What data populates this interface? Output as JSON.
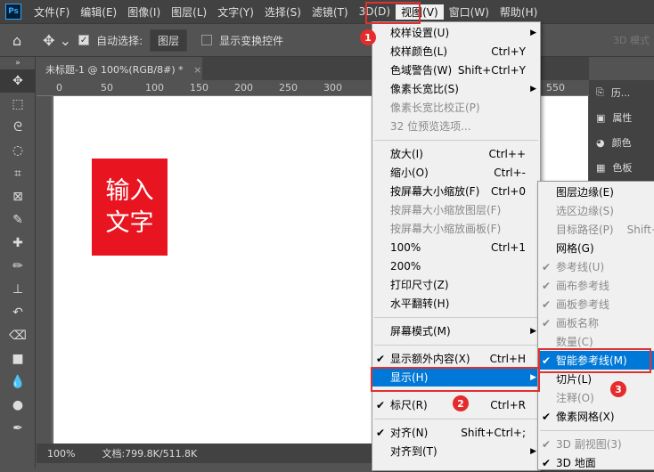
{
  "menubar": {
    "logo": "Ps",
    "items": [
      "文件(F)",
      "编辑(E)",
      "图像(I)",
      "图层(L)",
      "文字(Y)",
      "选择(S)",
      "滤镜(T)",
      "3D(D)",
      "视图(V)",
      "窗口(W)",
      "帮助(H)"
    ]
  },
  "options": {
    "auto_select_label": "自动选择:",
    "auto_select_value": "图层",
    "show_transform_label": "显示变换控件",
    "mode_3d": "3D 模式"
  },
  "document": {
    "tab_title": "未标题-1 @ 100%(RGB/8#) *",
    "close": "×",
    "ruler_ticks": [
      "0",
      "50",
      "100",
      "150",
      "200",
      "250",
      "300"
    ],
    "ruler_right": "550",
    "canvas_text": "输入\n文字",
    "canvas_text_color": "#e8141f"
  },
  "status": {
    "zoom": "100%",
    "doc_size": "文档:799.8K/511.8K"
  },
  "right_panel": {
    "items": [
      "历...",
      "属性",
      "颜色",
      "色板"
    ]
  },
  "view_menu": {
    "items": [
      {
        "label": "校样设置(U)",
        "submenu": true
      },
      {
        "label": "校样颜色(L)",
        "shortcut": "Ctrl+Y"
      },
      {
        "label": "色域警告(W)",
        "shortcut": "Shift+Ctrl+Y"
      },
      {
        "label": "像素长宽比(S)",
        "submenu": true
      },
      {
        "label": "像素长宽比校正(P)",
        "disabled": true
      },
      {
        "label": "32 位预览选项...",
        "disabled": true
      },
      {
        "sep": true
      },
      {
        "label": "放大(I)",
        "shortcut": "Ctrl++"
      },
      {
        "label": "缩小(O)",
        "shortcut": "Ctrl+-"
      },
      {
        "label": "按屏幕大小缩放(F)",
        "shortcut": "Ctrl+0"
      },
      {
        "label": "按屏幕大小缩放图层(F)",
        "disabled": true
      },
      {
        "label": "按屏幕大小缩放画板(F)",
        "disabled": true
      },
      {
        "label": "100%",
        "shortcut": "Ctrl+1"
      },
      {
        "label": "200%"
      },
      {
        "label": "打印尺寸(Z)"
      },
      {
        "label": "水平翻转(H)"
      },
      {
        "sep": true
      },
      {
        "label": "屏幕模式(M)",
        "submenu": true
      },
      {
        "sep": true
      },
      {
        "label": "显示额外内容(X)",
        "shortcut": "Ctrl+H",
        "checked": true
      },
      {
        "label": "显示(H)",
        "submenu": true,
        "highlighted": true
      },
      {
        "sep": true
      },
      {
        "label": "标尺(R)",
        "shortcut": "Ctrl+R",
        "checked": true
      },
      {
        "sep": true
      },
      {
        "label": "对齐(N)",
        "shortcut": "Shift+Ctrl+;",
        "checked": true
      },
      {
        "label": "对齐到(T)",
        "submenu": true
      }
    ]
  },
  "show_menu": {
    "items": [
      {
        "label": "图层边缘(E)"
      },
      {
        "label": "选区边缘(S)",
        "disabled": true
      },
      {
        "label": "目标路径(P)",
        "shortcut": "Shift+",
        "disabled": true
      },
      {
        "label": "网格(G)"
      },
      {
        "label": "参考线(U)",
        "checked": true,
        "disabled": true
      },
      {
        "label": "画布参考线",
        "checked": true,
        "disabled": true
      },
      {
        "label": "画板参考线",
        "checked": true,
        "disabled": true
      },
      {
        "label": "画板名称",
        "checked": true,
        "disabled": true
      },
      {
        "label": "数量(C)",
        "disabled": true
      },
      {
        "label": "智能参考线(M)",
        "checked": true,
        "highlighted": true
      },
      {
        "label": "切片(L)"
      },
      {
        "label": "注释(O)",
        "disabled": true
      },
      {
        "label": "像素网格(X)",
        "checked": true
      },
      {
        "sep": true
      },
      {
        "label": "3D 副视图(3)",
        "checked": true,
        "disabled": true
      },
      {
        "label": "3D 地面",
        "checked": true
      }
    ]
  },
  "annotations": {
    "badges": [
      "1",
      "2",
      "3"
    ],
    "color": "#e52b2b"
  }
}
